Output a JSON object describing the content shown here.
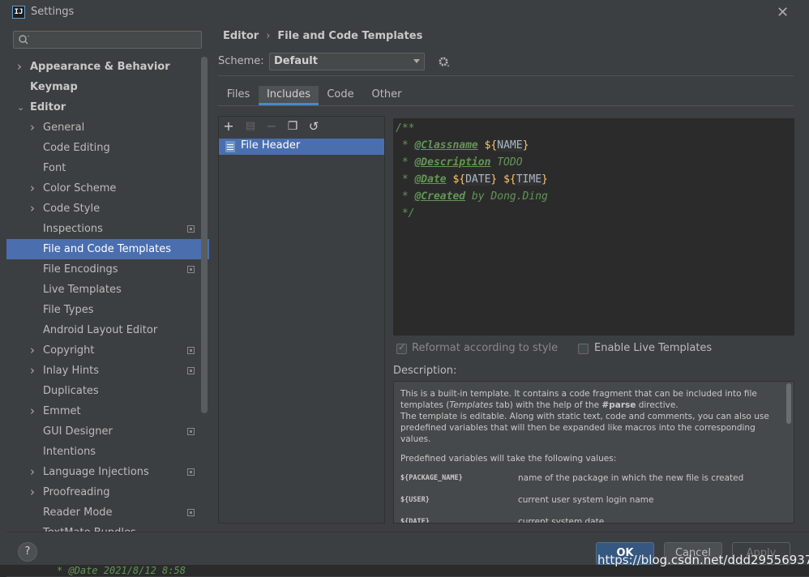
{
  "window": {
    "title": "Settings"
  },
  "sidebar": {
    "search_placeholder": "",
    "items": [
      {
        "label": "Appearance & Behavior",
        "level": 0,
        "expandable": true,
        "expanded": false,
        "bold": true,
        "project": false
      },
      {
        "label": "Keymap",
        "level": 0,
        "expandable": false,
        "bold": true,
        "project": false
      },
      {
        "label": "Editor",
        "level": 0,
        "expandable": true,
        "expanded": true,
        "bold": true,
        "project": false
      },
      {
        "label": "General",
        "level": 1,
        "expandable": true,
        "expanded": false,
        "project": false
      },
      {
        "label": "Code Editing",
        "level": 1,
        "expandable": false,
        "project": false
      },
      {
        "label": "Font",
        "level": 1,
        "expandable": false,
        "project": false
      },
      {
        "label": "Color Scheme",
        "level": 1,
        "expandable": true,
        "expanded": false,
        "project": false
      },
      {
        "label": "Code Style",
        "level": 1,
        "expandable": true,
        "expanded": false,
        "project": false
      },
      {
        "label": "Inspections",
        "level": 1,
        "expandable": false,
        "project": true
      },
      {
        "label": "File and Code Templates",
        "level": 1,
        "expandable": false,
        "project": false,
        "selected": true
      },
      {
        "label": "File Encodings",
        "level": 1,
        "expandable": false,
        "project": true
      },
      {
        "label": "Live Templates",
        "level": 1,
        "expandable": false,
        "project": false
      },
      {
        "label": "File Types",
        "level": 1,
        "expandable": false,
        "project": false
      },
      {
        "label": "Android Layout Editor",
        "level": 1,
        "expandable": false,
        "project": false
      },
      {
        "label": "Copyright",
        "level": 1,
        "expandable": true,
        "expanded": false,
        "project": true
      },
      {
        "label": "Inlay Hints",
        "level": 1,
        "expandable": true,
        "expanded": false,
        "project": true
      },
      {
        "label": "Duplicates",
        "level": 1,
        "expandable": false,
        "project": false
      },
      {
        "label": "Emmet",
        "level": 1,
        "expandable": true,
        "expanded": false,
        "project": false
      },
      {
        "label": "GUI Designer",
        "level": 1,
        "expandable": false,
        "project": true
      },
      {
        "label": "Intentions",
        "level": 1,
        "expandable": false,
        "project": false
      },
      {
        "label": "Language Injections",
        "level": 1,
        "expandable": true,
        "expanded": false,
        "project": true
      },
      {
        "label": "Proofreading",
        "level": 1,
        "expandable": true,
        "expanded": false,
        "project": false
      },
      {
        "label": "Reader Mode",
        "level": 1,
        "expandable": false,
        "project": true
      },
      {
        "label": "TextMate Bundles",
        "level": 1,
        "expandable": false,
        "project": false
      }
    ]
  },
  "breadcrumb": {
    "parent": "Editor",
    "separator": "›",
    "current": "File and Code Templates"
  },
  "scheme": {
    "label": "Scheme:",
    "value": "Default"
  },
  "tabs": [
    "Files",
    "Includes",
    "Code",
    "Other"
  ],
  "active_tab": "Includes",
  "templates_list": {
    "items": [
      "File Header"
    ],
    "selected": "File Header"
  },
  "editor": {
    "lines": [
      [
        {
          "t": "/**",
          "c": "c-cm"
        }
      ],
      [
        {
          "t": " * ",
          "c": "c-cm"
        },
        {
          "t": "@Classname",
          "c": "c-tag"
        },
        {
          "t": " ",
          "c": "c-cm"
        },
        {
          "t": "${",
          "c": "c-var"
        },
        {
          "t": "NAME",
          "c": "c-name"
        },
        {
          "t": "}",
          "c": "c-var"
        }
      ],
      [
        {
          "t": " * ",
          "c": "c-cm"
        },
        {
          "t": "@Description",
          "c": "c-tag"
        },
        {
          "t": " TODO",
          "c": "c-cm"
        }
      ],
      [
        {
          "t": " * ",
          "c": "c-cm"
        },
        {
          "t": "@Date",
          "c": "c-tag"
        },
        {
          "t": " ",
          "c": "c-cm"
        },
        {
          "t": "${",
          "c": "c-var"
        },
        {
          "t": "DATE",
          "c": "c-name"
        },
        {
          "t": "}",
          "c": "c-var"
        },
        {
          "t": " ",
          "c": "c-cm"
        },
        {
          "t": "${",
          "c": "c-var"
        },
        {
          "t": "TIME",
          "c": "c-name"
        },
        {
          "t": "}",
          "c": "c-var"
        }
      ],
      [
        {
          "t": " * ",
          "c": "c-cm"
        },
        {
          "t": "@Created",
          "c": "c-tag"
        },
        {
          "t": " by Dong.Ding",
          "c": "c-cm"
        }
      ],
      [
        {
          "t": " */",
          "c": "c-cm"
        }
      ]
    ]
  },
  "options": {
    "reformat": {
      "label": "Reformat according to style",
      "checked": true,
      "enabled": false
    },
    "live_templates": {
      "label": "Enable Live Templates",
      "checked": false,
      "enabled": true
    }
  },
  "description": {
    "label": "Description:",
    "p1_a": "This is a built-in template. It contains a code fragment that can be included into file templates (",
    "p1_italic": "Templates",
    "p1_b": " tab) with the help of the ",
    "p1_bold": "#parse",
    "p1_c": " directive.",
    "p2": "The template is editable. Along with static text, code and comments, you can also use predefined variables that will then be expanded like macros into the corresponding values.",
    "p3": "Predefined variables will take the following values:",
    "vars": [
      {
        "name": "${PACKAGE_NAME}",
        "desc": "name of the package in which the new file is created"
      },
      {
        "name": "${USER}",
        "desc": "current user system login name"
      },
      {
        "name": "${DATE}",
        "desc": "current system date"
      }
    ]
  },
  "buttons": {
    "help": "?",
    "ok": "OK",
    "cancel": "Cancel",
    "apply": "Apply"
  },
  "background_code": " * @Date 2021/8/12 8:58",
  "watermark": "https://blog.csdn.net/ddd295569371",
  "colors": {
    "accent": "#4b6eaf",
    "ok": "#365880",
    "bg": "#3c3f41",
    "comment": "#629755"
  }
}
